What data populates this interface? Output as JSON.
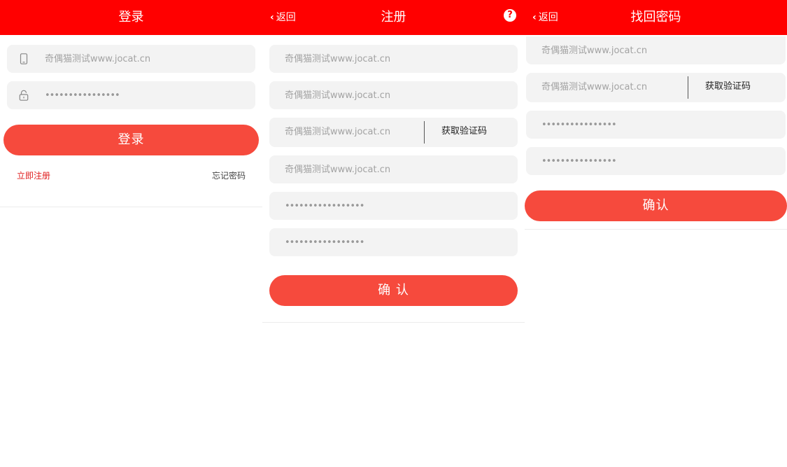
{
  "login": {
    "title": "登录",
    "phone_placeholder": "奇偶猫测试www.jocat.cn",
    "password_value": "••••••••••••••••",
    "submit_label": "登录",
    "register_link": "立即注册",
    "forgot_link": "忘记密码",
    "icons": {
      "phone": "phone-icon",
      "lock": "lock-icon"
    }
  },
  "register": {
    "back_label": "返回",
    "title": "注册",
    "help_icon": "?",
    "field1_placeholder": "奇偶猫测试www.jocat.cn",
    "field2_placeholder": "奇偶猫测试www.jocat.cn",
    "code_placeholder": "奇偶猫测试www.jocat.cn",
    "get_code_label": "获取验证码",
    "field4_placeholder": "奇偶猫测试www.jocat.cn",
    "password_value": "•••••••••••••••••",
    "confirm_password_value": "•••••••••••••••••",
    "submit_label": "确 认"
  },
  "recover": {
    "back_label": "返回",
    "title": "找回密码",
    "field1_placeholder": "奇偶猫测试www.jocat.cn",
    "code_placeholder": "奇偶猫测试www.jocat.cn",
    "get_code_label": "获取验证码",
    "password_value": "••••••••••••••••",
    "confirm_password_value": "••••••••••••••••",
    "submit_label": "确认"
  },
  "colors": {
    "header_bg": "#ff0000",
    "button_bg": "#f64a3d",
    "field_bg": "#f3f3f3",
    "link_red": "#e02020"
  }
}
